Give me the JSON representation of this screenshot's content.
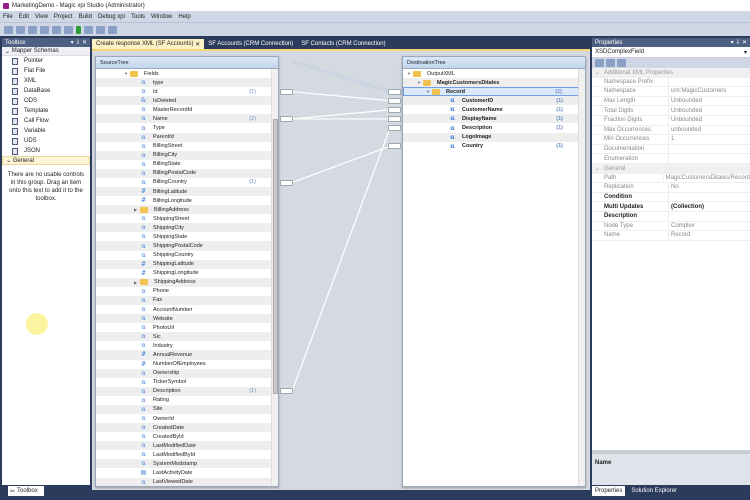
{
  "window": {
    "title": "MarketingDemo - Magic xpi Studio (Administrator)"
  },
  "menu": [
    "File",
    "Edit",
    "View",
    "Project",
    "Build",
    "Debug xpi",
    "Tools",
    "Window",
    "Help"
  ],
  "toolbox": {
    "title": "Toolbox",
    "pin": "▾ ⇩ ✕",
    "group1": "Mapper Schemas",
    "items": [
      "Pointer",
      "Flat File",
      "XML",
      "DataBase",
      "ODS",
      "Template",
      "Call Flow",
      "Variable",
      "UDS",
      "JSON"
    ],
    "group2": "General",
    "note": "There are no usable controls in this group. Drag an item onto this text to add it to the toolbox.",
    "tab": "Toolbox"
  },
  "tabs": [
    "Create response XML (SF Accounts)",
    "SF Accounts (CRM Connection)",
    "SF Contacts (CRM Connection)"
  ],
  "source": {
    "title": "SourceTree",
    "root": "Fields",
    "rows": [
      {
        "n": "type",
        "t": "a"
      },
      {
        "n": "Id",
        "t": "a",
        "c": "(1)"
      },
      {
        "n": "IsDeleted",
        "t": "b"
      },
      {
        "n": "MasterRecordId",
        "t": "a"
      },
      {
        "n": "Name",
        "t": "a",
        "c": "(2)"
      },
      {
        "n": "Type",
        "t": "a"
      },
      {
        "n": "ParentId",
        "t": "a"
      },
      {
        "n": "BillingStreet",
        "t": "a"
      },
      {
        "n": "BillingCity",
        "t": "a"
      },
      {
        "n": "BillingState",
        "t": "a"
      },
      {
        "n": "BillingPostalCode",
        "t": "a"
      },
      {
        "n": "BillingCountry",
        "t": "a",
        "c": "(1)"
      },
      {
        "n": "BillingLatitude",
        "t": "n"
      },
      {
        "n": "BillingLongitude",
        "t": "n"
      },
      {
        "n": "BillingAddress",
        "t": "f"
      },
      {
        "n": "ShippingStreet",
        "t": "a"
      },
      {
        "n": "ShippingCity",
        "t": "a"
      },
      {
        "n": "ShippingState",
        "t": "a"
      },
      {
        "n": "ShippingPostalCode",
        "t": "a"
      },
      {
        "n": "ShippingCountry",
        "t": "a"
      },
      {
        "n": "ShippingLatitude",
        "t": "n"
      },
      {
        "n": "ShippingLongitude",
        "t": "n"
      },
      {
        "n": "ShippingAddress",
        "t": "f"
      },
      {
        "n": "Phone",
        "t": "a"
      },
      {
        "n": "Fax",
        "t": "a"
      },
      {
        "n": "AccountNumber",
        "t": "a"
      },
      {
        "n": "Website",
        "t": "a"
      },
      {
        "n": "PhotoUrl",
        "t": "a"
      },
      {
        "n": "Sic",
        "t": "a"
      },
      {
        "n": "Industry",
        "t": "a"
      },
      {
        "n": "AnnualRevenue",
        "t": "n"
      },
      {
        "n": "NumberOfEmployees",
        "t": "n"
      },
      {
        "n": "Ownership",
        "t": "a"
      },
      {
        "n": "TickerSymbol",
        "t": "a"
      },
      {
        "n": "Description",
        "t": "a",
        "c": "(1)"
      },
      {
        "n": "Rating",
        "t": "a"
      },
      {
        "n": "Site",
        "t": "a"
      },
      {
        "n": "OwnerId",
        "t": "a"
      },
      {
        "n": "CreatedDate",
        "t": "a"
      },
      {
        "n": "CreatedById",
        "t": "a"
      },
      {
        "n": "LastModifiedDate",
        "t": "a"
      },
      {
        "n": "LastModifiedById",
        "t": "a"
      },
      {
        "n": "SystemModstamp",
        "t": "a"
      },
      {
        "n": "LastActivityDate",
        "t": "d"
      },
      {
        "n": "LastViewedDate",
        "t": "a"
      }
    ]
  },
  "destination": {
    "title": "DestinationTree",
    "root": "OutputXML",
    "parent": "MagicCustomersDitales",
    "record": "Record",
    "record_count": "(1)",
    "rows": [
      {
        "n": "CustomerID",
        "c": "(1)"
      },
      {
        "n": "CustomerName",
        "c": "(1)"
      },
      {
        "n": "DisplayName",
        "c": "(1)"
      },
      {
        "n": "Description",
        "c": "(1)"
      },
      {
        "n": "LogoImage"
      },
      {
        "n": "Country",
        "c": "(1)"
      }
    ]
  },
  "mappings": [
    [
      "Id",
      "CustomerID"
    ],
    [
      "Name",
      "CustomerName"
    ],
    [
      "Name",
      "DisplayName"
    ],
    [
      "Description",
      "Description"
    ],
    [
      "BillingCountry",
      "Country"
    ]
  ],
  "properties": {
    "title": "Properties",
    "selected": "XSDComplexField",
    "cat1": "Additional XML Properties",
    "rows1": [
      [
        "Namespace Prefix",
        ""
      ],
      [
        "Namespace",
        "urn:MagicCustomers"
      ],
      [
        "Max Length",
        "Unbounded"
      ],
      [
        "Total Digits",
        "Unbounded"
      ],
      [
        "Fraction Digits",
        "Unbounded"
      ],
      [
        "Max Occurrences",
        "unbounded"
      ],
      [
        "Min Occurrences",
        "1"
      ],
      [
        "Documentation",
        ""
      ],
      [
        "Enumeration",
        ""
      ]
    ],
    "cat2": "General",
    "rows2": [
      [
        "Path",
        "MagicCustomersDitales/Record",
        false
      ],
      [
        "Replication",
        "No",
        false
      ],
      [
        "Condition",
        "",
        true
      ],
      [
        "Multi Updates",
        "(Collection)",
        true
      ],
      [
        "Description",
        "",
        true
      ],
      [
        "Node Type",
        "Complex",
        false
      ],
      [
        "Name",
        "Record",
        false
      ]
    ],
    "desc_title": "Name",
    "tabs": [
      "Properties",
      "Solution Explorer"
    ]
  }
}
